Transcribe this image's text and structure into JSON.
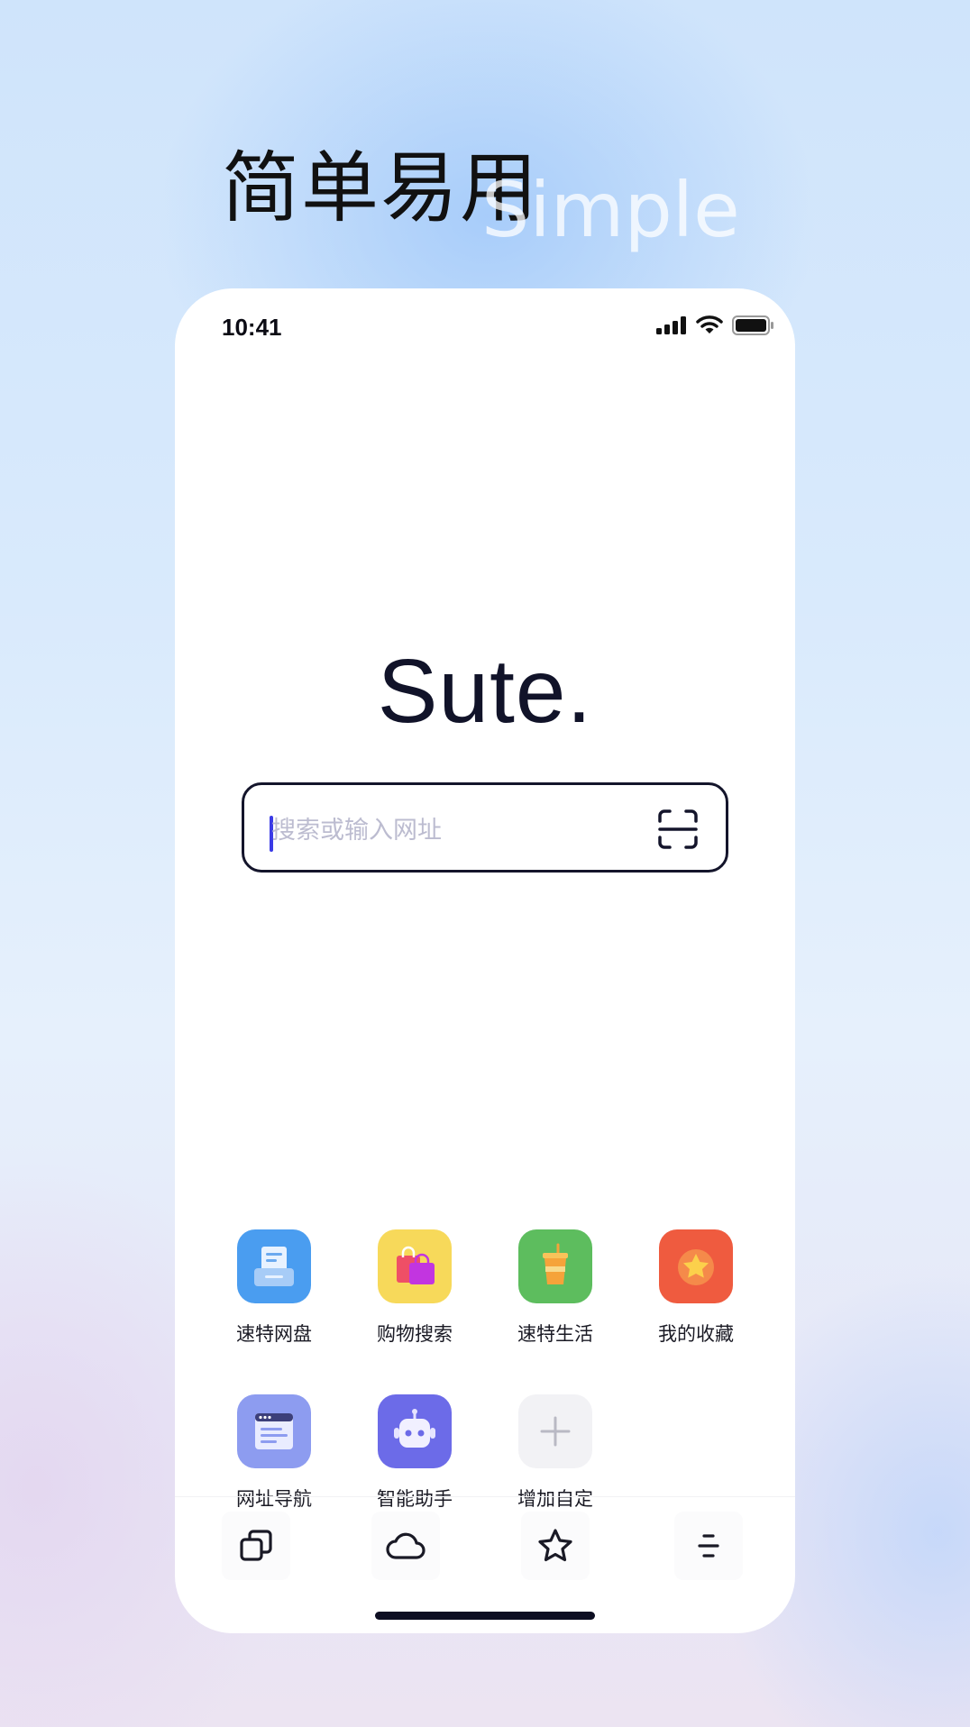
{
  "promo": {
    "title": "简单易用",
    "subtitle": "Simple"
  },
  "status_bar": {
    "time": "10:41"
  },
  "brand": {
    "logo_text": "Sute."
  },
  "search": {
    "placeholder": "搜索或输入网址",
    "value": ""
  },
  "shortcuts": [
    {
      "label": "速特网盘",
      "icon": "cloud-drive-icon",
      "color": "#4a9df0"
    },
    {
      "label": "购物搜索",
      "icon": "shopping-bag-icon",
      "color": "#f7d95a"
    },
    {
      "label": "速特生活",
      "icon": "drink-cup-icon",
      "color": "#5dbd5e"
    },
    {
      "label": "我的收藏",
      "icon": "star-badge-icon",
      "color": "#ef5b3f"
    },
    {
      "label": "网址导航",
      "icon": "browser-window-icon",
      "color": "#8d9cf0"
    },
    {
      "label": "智能助手",
      "icon": "robot-icon",
      "color": "#6c6be8"
    },
    {
      "label": "增加自定",
      "icon": "plus-icon",
      "color": "#f2f2f5"
    }
  ],
  "tabbar": [
    {
      "name": "tabs-icon"
    },
    {
      "name": "cloud-icon"
    },
    {
      "name": "star-icon"
    },
    {
      "name": "menu-icon"
    }
  ]
}
